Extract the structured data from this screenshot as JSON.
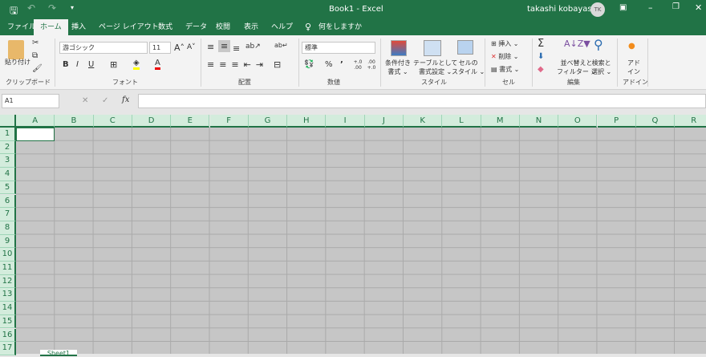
{
  "title_bar": {
    "doc_title": "Book1  -  Excel",
    "user": "takashi kobayashi",
    "avatar_initials": "TK"
  },
  "tabs": [
    "ファイル",
    "ホーム",
    "挿入",
    "ページ レイアウト",
    "数式",
    "データ",
    "校閲",
    "表示",
    "ヘルプ"
  ],
  "active_tab": "ホーム",
  "tell_me": "何をしますか",
  "ribbon": {
    "clipboard": {
      "paste": "貼り付け",
      "label": "クリップボード"
    },
    "font": {
      "name": "游ゴシック",
      "size": "11",
      "bold": "B",
      "italic": "I",
      "underline": "U",
      "label": "フォント"
    },
    "alignment": {
      "label": "配置"
    },
    "number": {
      "format": "標準",
      "percent": "%",
      "comma": "’",
      "inc_decimal": "+.0 .00",
      "dec_decimal": ".00 +.0",
      "label": "数値"
    },
    "styles": {
      "conditional": [
        "条件付き",
        "書式 ⌄"
      ],
      "table": [
        "テーブルとして",
        "書式設定 ⌄"
      ],
      "cell_styles": [
        "セルの",
        "スタイル ⌄"
      ],
      "label": "スタイル"
    },
    "cells": {
      "insert": "挿入",
      "delete": "削除",
      "format": "書式",
      "label": "セル"
    },
    "editing": {
      "sigma": "Σ",
      "sort": [
        "並べ替えと",
        "フィルター ⌄"
      ],
      "find": [
        "検索と",
        "選択 ⌄"
      ],
      "label": "編集"
    },
    "addin": {
      "btn": [
        "アド",
        "イン"
      ],
      "label": "アドイン"
    }
  },
  "formula_bar": {
    "name_box": "A1",
    "fx": "fx",
    "cancel": "✕",
    "enter": "✓",
    "value": ""
  },
  "columns": [
    "A",
    "B",
    "C",
    "D",
    "E",
    "F",
    "G",
    "H",
    "I",
    "J",
    "K",
    "L",
    "M",
    "N",
    "O",
    "P",
    "Q",
    "R"
  ],
  "rows": [
    "1",
    "2",
    "3",
    "4",
    "5",
    "6",
    "7",
    "8",
    "9",
    "10",
    "11",
    "12",
    "13",
    "14",
    "15",
    "16",
    "17"
  ],
  "sheet_tabs": [
    "Sheet1"
  ],
  "colors": {
    "brand": "#217346",
    "grid_bg": "#c6c6c6"
  }
}
